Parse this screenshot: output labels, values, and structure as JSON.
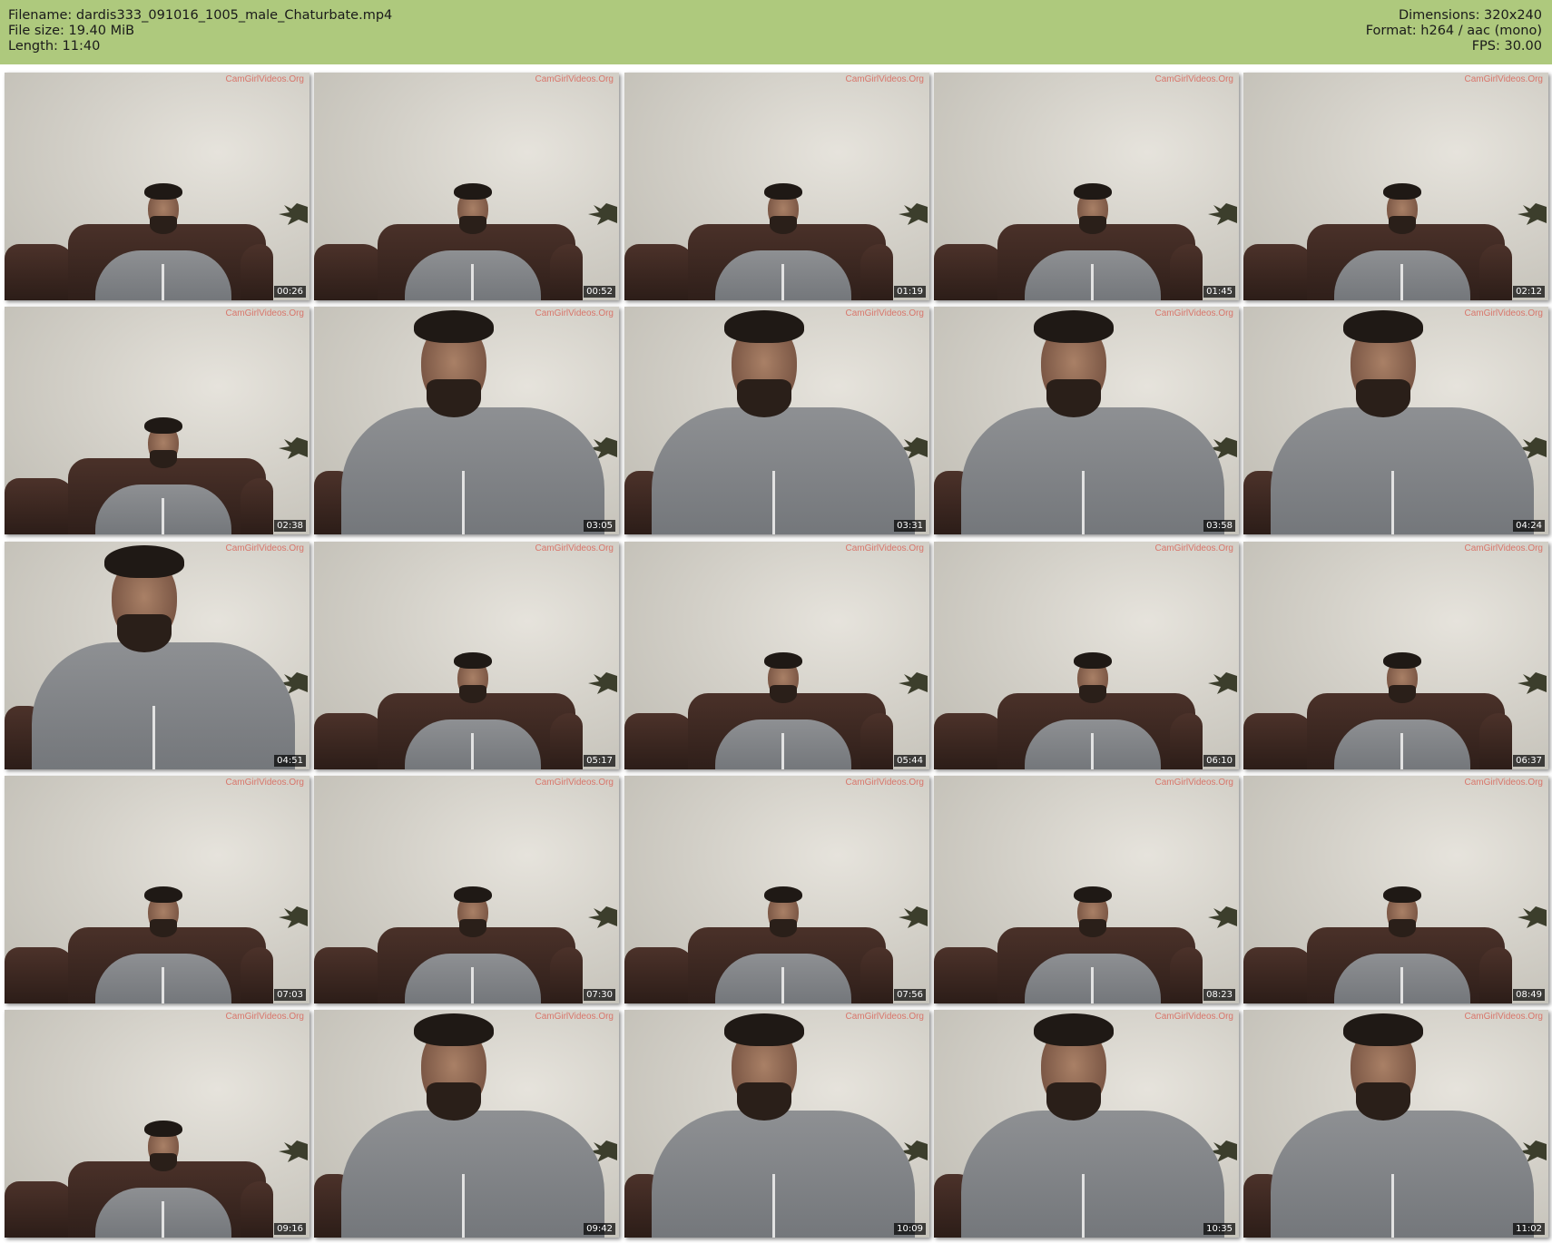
{
  "header": {
    "filename": "Filename: dardis333_091016_1005_male_Chaturbate.mp4",
    "filesize": "File size: 19.40 MiB",
    "length": "Length: 11:40",
    "dimensions": "Dimensions: 320x240",
    "format": "Format: h264 / aac (mono)",
    "fps": "FPS: 30.00",
    "background_color": "#aec97d"
  },
  "watermark": "CamGirlVideos.Org",
  "thumbnails": [
    {
      "time": "00:26",
      "framing": "far"
    },
    {
      "time": "00:52",
      "framing": "far"
    },
    {
      "time": "01:19",
      "framing": "far"
    },
    {
      "time": "01:45",
      "framing": "far"
    },
    {
      "time": "02:12",
      "framing": "far"
    },
    {
      "time": "02:38",
      "framing": "far"
    },
    {
      "time": "03:05",
      "framing": "close"
    },
    {
      "time": "03:31",
      "framing": "close"
    },
    {
      "time": "03:58",
      "framing": "close"
    },
    {
      "time": "04:24",
      "framing": "close"
    },
    {
      "time": "04:51",
      "framing": "close"
    },
    {
      "time": "05:17",
      "framing": "far"
    },
    {
      "time": "05:44",
      "framing": "far"
    },
    {
      "time": "06:10",
      "framing": "far"
    },
    {
      "time": "06:37",
      "framing": "far"
    },
    {
      "time": "07:03",
      "framing": "far"
    },
    {
      "time": "07:30",
      "framing": "far"
    },
    {
      "time": "07:56",
      "framing": "far"
    },
    {
      "time": "08:23",
      "framing": "far"
    },
    {
      "time": "08:49",
      "framing": "far"
    },
    {
      "time": "09:16",
      "framing": "far"
    },
    {
      "time": "09:42",
      "framing": "close"
    },
    {
      "time": "10:09",
      "framing": "close"
    },
    {
      "time": "10:35",
      "framing": "close"
    },
    {
      "time": "11:02",
      "framing": "close"
    }
  ]
}
